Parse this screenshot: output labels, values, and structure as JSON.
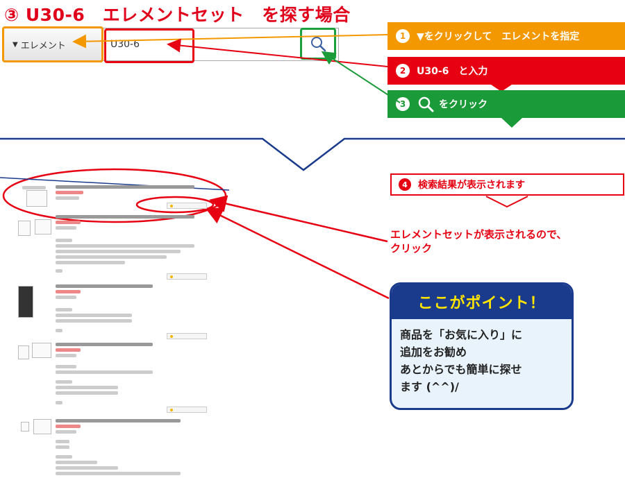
{
  "title": "③ U30-6　エレメントセット　を探す場合",
  "search": {
    "dropdown_label": "エレメント",
    "query": "U30-6"
  },
  "steps": [
    {
      "num": "1",
      "text": "▼をクリックして　エレメントを指定"
    },
    {
      "num": "2",
      "text": "U30-6　と入力"
    },
    {
      "num": "3",
      "text": "をクリック"
    }
  ],
  "result": {
    "num": "4",
    "text": "検索結果が表示されます"
  },
  "click_note": "エレメントセットが表示されるので、\nクリック",
  "point": {
    "heading": "ここがポイント！",
    "body": "商品を「お気に入り」に\n追加をお勧め\nあとからでも簡単に探せ\nます (^^)/"
  },
  "colors": {
    "orange": "#f39800",
    "red": "#e60012",
    "green": "#1a9a38",
    "navy": "#1a3a8c",
    "yellow": "#ffe500"
  }
}
